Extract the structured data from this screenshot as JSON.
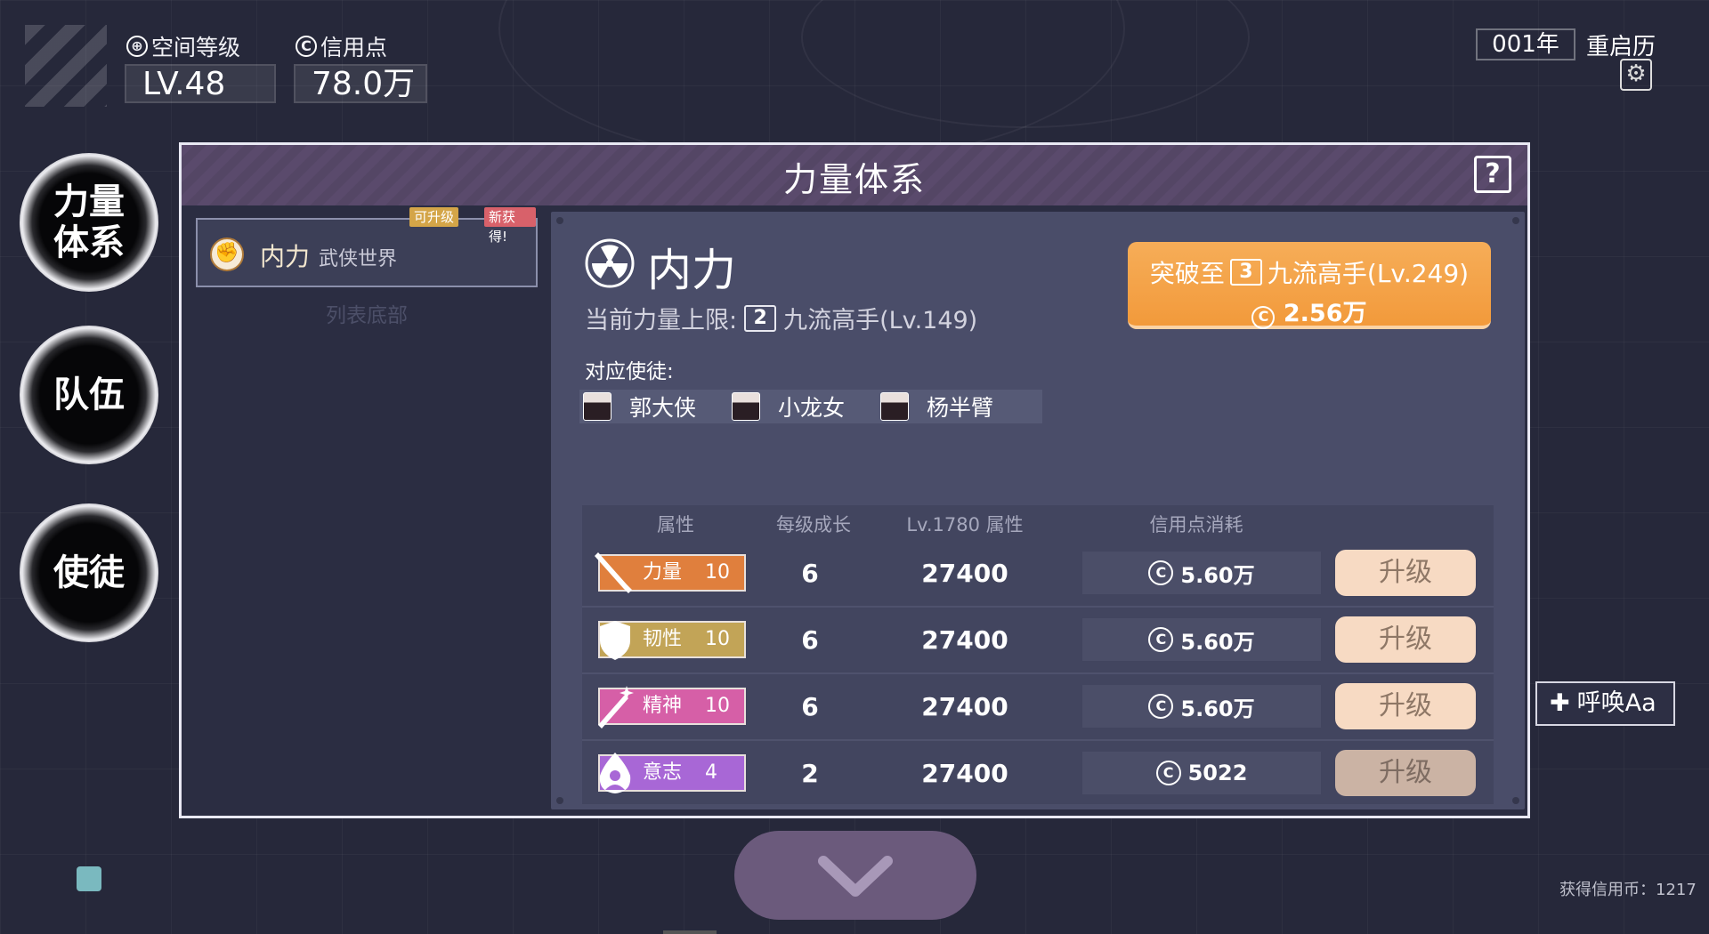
{
  "top_stats": {
    "space_level_label": "空间等级",
    "space_level_value": "LV.48",
    "credit_label": "信用点",
    "credit_value": "78.0万"
  },
  "top_right": {
    "year": "001年",
    "restart_calendar": "重启历"
  },
  "left_nav": [
    {
      "label": "力量\n体系"
    },
    {
      "label": "队伍"
    },
    {
      "label": "使徒"
    }
  ],
  "panel": {
    "title": "力量体系",
    "help": "?"
  },
  "system_list": {
    "items": [
      {
        "name": "内力",
        "world": "武侠世界",
        "tag_upgradable": "可升级",
        "tag_new": "新获得!"
      }
    ],
    "bottom_text": "列表底部"
  },
  "detail": {
    "name": "内力",
    "current_limit_label": "当前力量上限:",
    "current_limit_tier": "2",
    "current_limit_text": "九流高手(Lv.149)",
    "breakthrough": {
      "prefix": "突破至",
      "tier": "3",
      "target": "九流高手(Lv.249)",
      "cost": "2.56万"
    },
    "disciples_label": "对应使徒:",
    "disciples": [
      "郭大侠",
      "小龙女",
      "杨半臂"
    ]
  },
  "attr_table": {
    "headers": [
      "属性",
      "每级成长",
      "Lv.1780 属性",
      "信用点消耗"
    ],
    "rows": [
      {
        "name": "力量",
        "level": "10",
        "growth": "6",
        "value": "27400",
        "cost": "5.60万",
        "button": "升级",
        "color": "#e07f3d"
      },
      {
        "name": "韧性",
        "level": "10",
        "growth": "6",
        "value": "27400",
        "cost": "5.60万",
        "button": "升级",
        "color": "#c2a457"
      },
      {
        "name": "精神",
        "level": "10",
        "growth": "6",
        "value": "27400",
        "cost": "5.60万",
        "button": "升级",
        "color": "#d65fa7"
      },
      {
        "name": "意志",
        "level": "4",
        "growth": "2",
        "value": "27400",
        "cost": "5022",
        "button": "升级",
        "color": "#a867d6"
      }
    ]
  },
  "summon_button": "呼唤Aa",
  "credit_gain": "获得信用币：1217"
}
